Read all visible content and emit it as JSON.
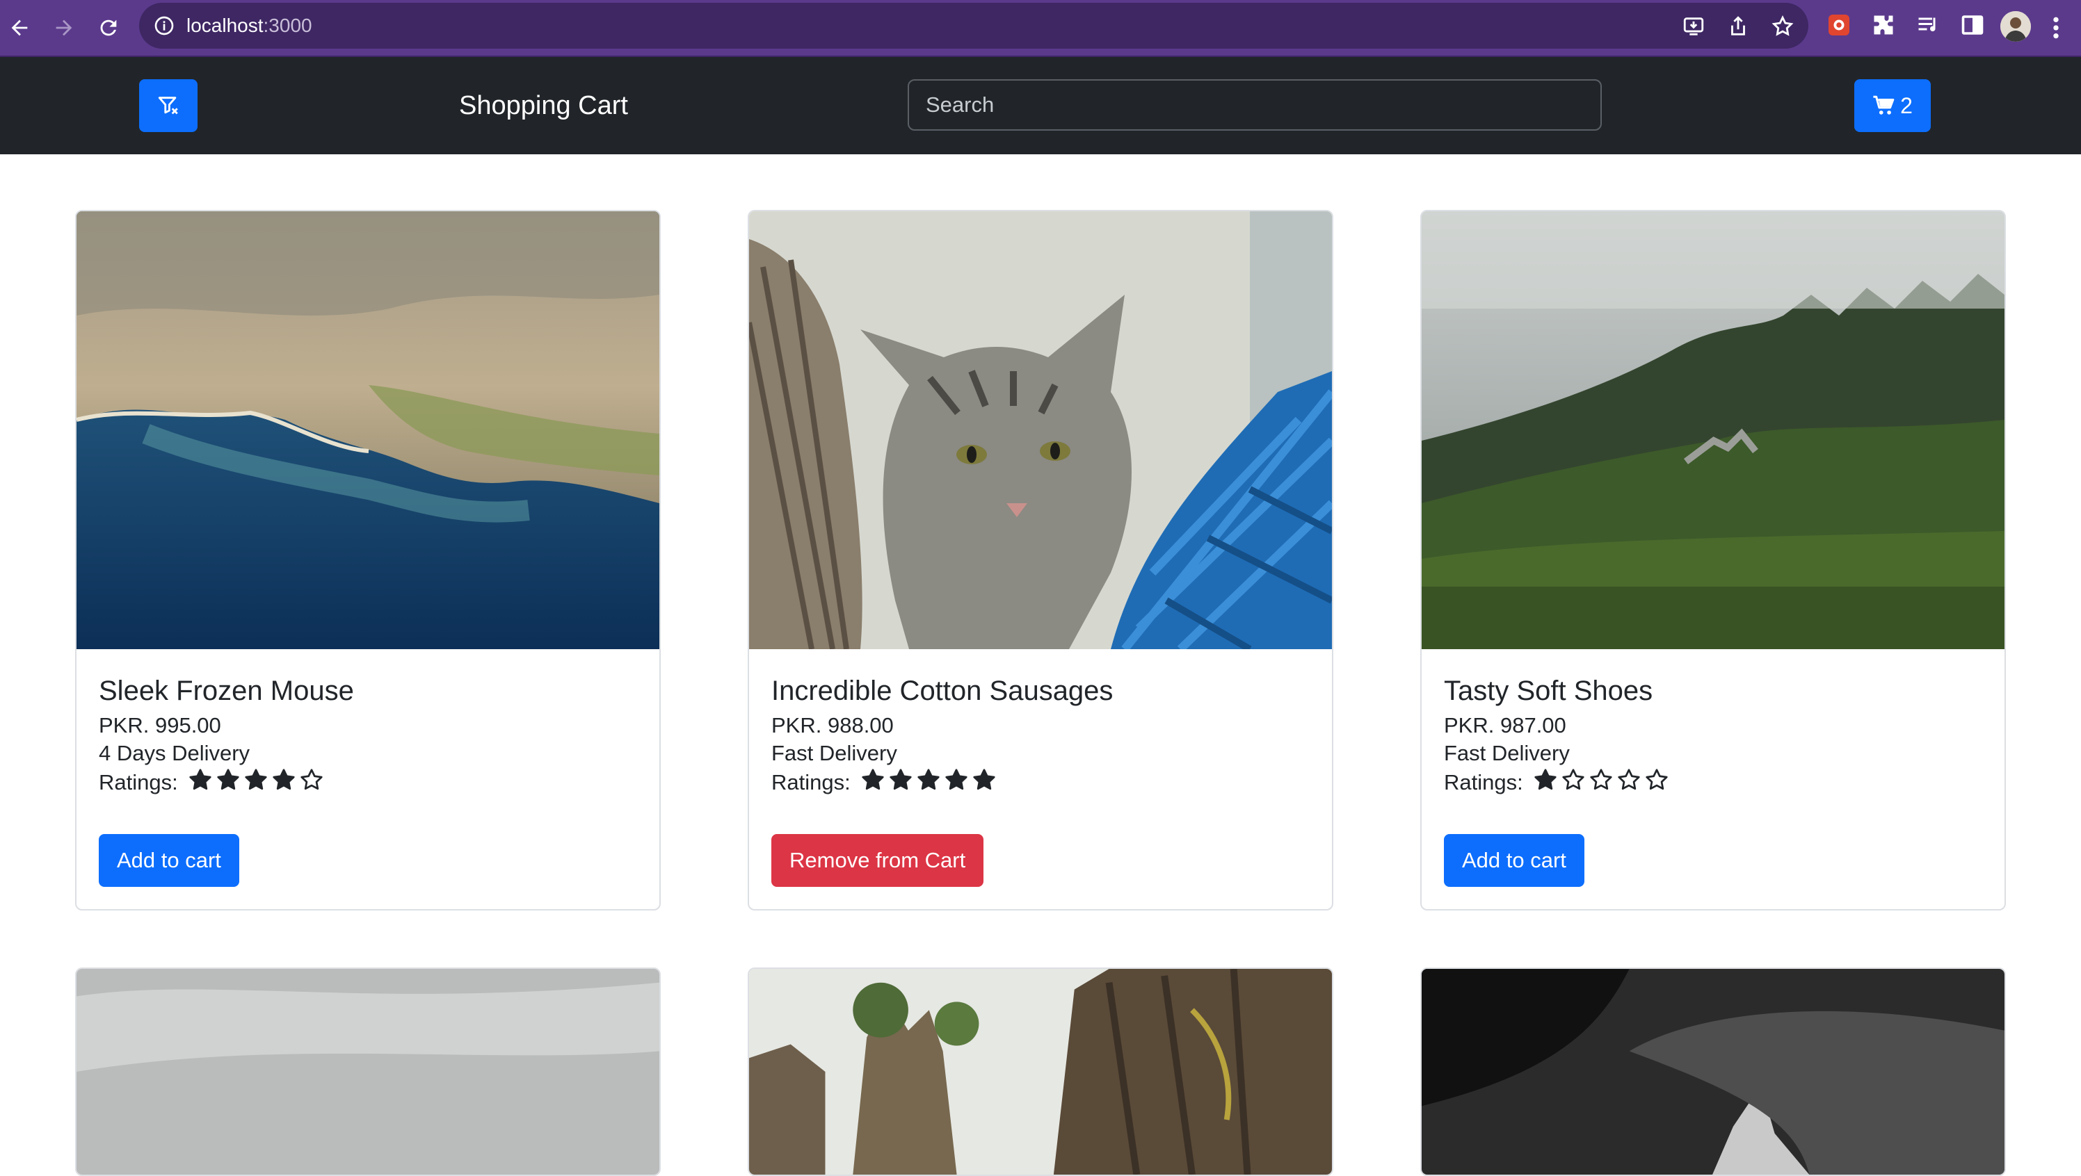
{
  "browser": {
    "url_host": "localhost",
    "url_port": ":3000"
  },
  "navbar": {
    "brand": "Shopping Cart",
    "search_placeholder": "Search",
    "cart_count": "2"
  },
  "products": [
    {
      "title": "Sleek Frozen Mouse",
      "price": "PKR. 995.00",
      "delivery": "4 Days Delivery",
      "ratings_label": "Ratings:",
      "rating": 4,
      "button_label": "Add to cart",
      "button_kind": "primary",
      "image": "coastline-aerial"
    },
    {
      "title": "Incredible Cotton Sausages",
      "price": "PKR. 988.00",
      "delivery": "Fast Delivery",
      "ratings_label": "Ratings:",
      "rating": 5,
      "button_label": "Remove from Cart",
      "button_kind": "danger",
      "image": "tabby-kitten"
    },
    {
      "title": "Tasty Soft Shoes",
      "price": "PKR. 987.00",
      "delivery": "Fast Delivery",
      "ratings_label": "Ratings:",
      "rating": 1,
      "button_label": "Add to cart",
      "button_kind": "primary",
      "image": "misty-forest-hill"
    }
  ],
  "bottom_row_images": [
    "cloudy-sky",
    "rock-formations",
    "black-white-cat"
  ],
  "colors": {
    "primary": "#0d6efd",
    "danger": "#dc3545",
    "navbar": "#212529",
    "browser_frame": "#5b3a8c"
  }
}
